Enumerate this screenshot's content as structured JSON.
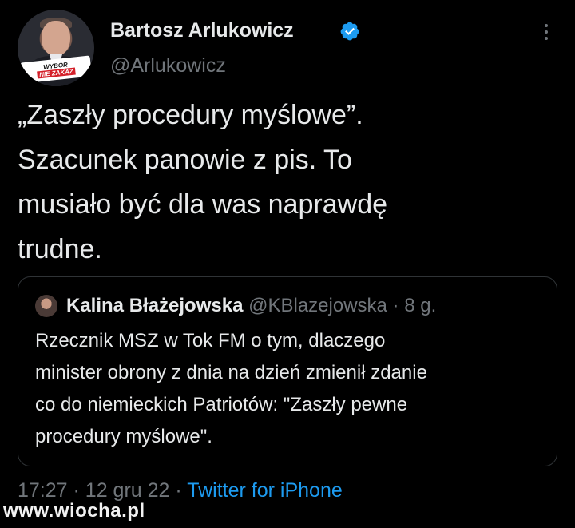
{
  "author": {
    "name": "Bartosz Arlukowicz",
    "handle": "@Arlukowicz",
    "verified": true,
    "avatar_badge": {
      "line1": "WYBÓR",
      "line2": "NIE ZAKAZ"
    }
  },
  "tweet": {
    "lines": [
      "„Zaszły procedury myślowe”.",
      "Szacunek panowie z pis. To",
      "musiało być dla was naprawdę",
      "trudne."
    ]
  },
  "quoted": {
    "name": "Kalina Błażejowska",
    "handle": "@KBlazejowska",
    "separator": "·",
    "time": "8 g.",
    "lines": [
      "Rzecznik MSZ w Tok FM o tym, dlaczego",
      "minister obrony z dnia na dzień zmienił zdanie",
      "co do niemieckich Patriotów: \"Zaszły pewne",
      "procedury myślowe\"."
    ]
  },
  "meta": {
    "time": "17:27",
    "sep1": "·",
    "date": "12 gru 22",
    "sep2": "·",
    "source": "Twitter for iPhone"
  },
  "watermark": "www.wiocha.pl",
  "colors": {
    "background": "#000000",
    "text": "#e7e9ea",
    "secondary": "#71767b",
    "accent": "#1d9bf0",
    "border": "#2f3336"
  },
  "icons": {
    "verified": "verified-badge-icon",
    "more": "more-options-icon"
  }
}
